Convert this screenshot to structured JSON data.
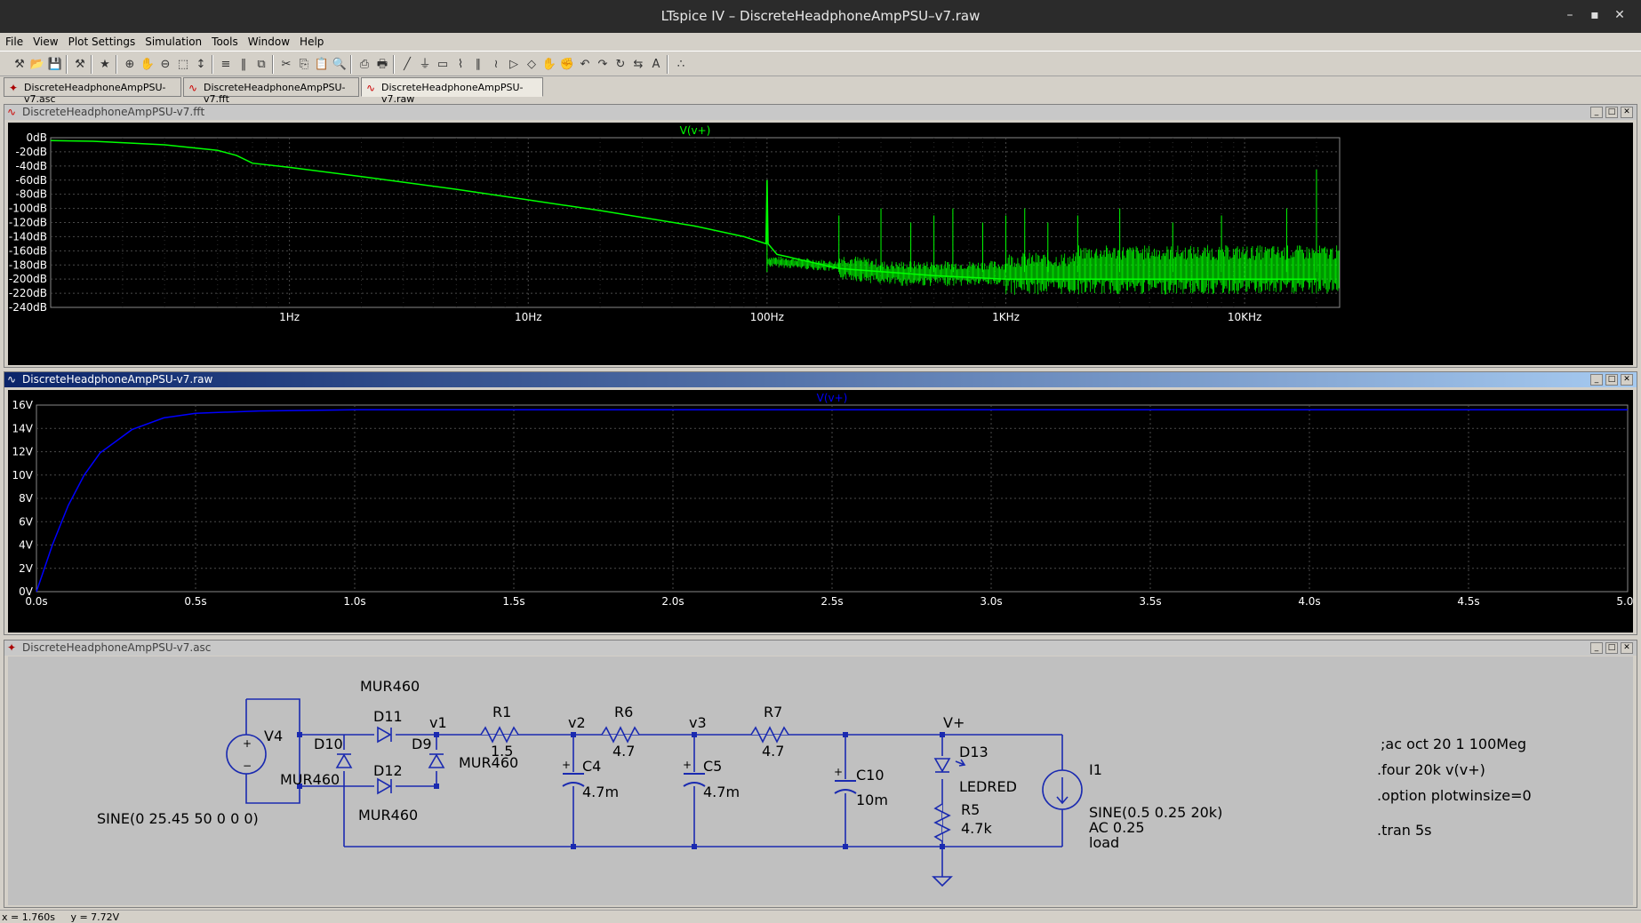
{
  "window": {
    "title": "LTspice IV – DiscreteHeadphoneAmpPSU–v7.raw",
    "minimize": "–",
    "maximize": "▪",
    "close": "✕"
  },
  "menu": [
    "File",
    "View",
    "Plot Settings",
    "Simulation",
    "Tools",
    "Window",
    "Help"
  ],
  "toolbar_icons": [
    "new-schematic",
    "open",
    "save",
    "control-panel",
    "run",
    "zoom-in",
    "pan",
    "zoom-out",
    "zoom-fit",
    "autorange",
    "tile-horizontal",
    "tile-vertical",
    "cascade",
    "cut",
    "copy",
    "paste",
    "find",
    "print-setup",
    "print",
    "wire",
    "ground",
    "label",
    "resistor",
    "capacitor",
    "inductor",
    "diode",
    "component",
    "move",
    "drag",
    "undo",
    "redo",
    "rotate",
    "mirror",
    "text",
    "spice-directive"
  ],
  "tabs": [
    {
      "label": "DiscreteHeadphoneAmpPSU-v7.asc",
      "icon": "schematic-icon"
    },
    {
      "label": "DiscreteHeadphoneAmpPSU-v7.fft",
      "icon": "waveform-icon"
    },
    {
      "label": "DiscreteHeadphoneAmpPSU-v7.raw",
      "icon": "waveform-icon"
    }
  ],
  "fft_window": {
    "title": "DiscreteHeadphoneAmpPSU-v7.fft"
  },
  "raw_window": {
    "title": "DiscreteHeadphoneAmpPSU-v7.raw"
  },
  "asc_window": {
    "title": "DiscreteHeadphoneAmpPSU-v7.asc"
  },
  "colors": {
    "fft_trace": "#00ff00",
    "tran_trace": "#0000ff",
    "plot_bg": "#000000",
    "grid": "#4a4a4a",
    "wire": "#1020a0",
    "schem_bg": "#c0c0c0"
  },
  "chart_data": [
    {
      "type": "line",
      "series": [
        {
          "name": "V(v+)",
          "color": "#00ff00",
          "x": [
            0.1,
            0.15,
            0.2,
            0.3,
            0.5,
            0.6,
            0.7,
            1,
            2,
            5,
            10,
            20,
            50,
            80,
            99,
            100,
            101,
            110,
            200,
            500,
            1000,
            2000,
            5000,
            10000,
            20000
          ],
          "y": [
            -4,
            -5,
            -7,
            -10,
            -18,
            -25,
            -36,
            -42,
            -55,
            -73,
            -88,
            -103,
            -125,
            -140,
            -150,
            -60,
            -150,
            -165,
            -185,
            -195,
            -200,
            -200,
            -200,
            -200,
            -200
          ]
        }
      ],
      "xscale": "log",
      "xlim": [
        0.1,
        25000
      ],
      "ylim": [
        -240,
        0
      ],
      "yticks": [
        "0dB",
        "-20dB",
        "-40dB",
        "-60dB",
        "-80dB",
        "-100dB",
        "-120dB",
        "-140dB",
        "-160dB",
        "-180dB",
        "-200dB",
        "-220dB",
        "-240dB"
      ],
      "xticks": [
        "1Hz",
        "10Hz",
        "100Hz",
        "1KHz",
        "10KHz"
      ],
      "grid": true
    },
    {
      "type": "line",
      "series": [
        {
          "name": "V(v+)",
          "color": "#0000ff",
          "x": [
            0,
            0.02,
            0.05,
            0.1,
            0.15,
            0.2,
            0.3,
            0.4,
            0.5,
            0.7,
            1.0,
            1.5,
            2.0,
            5.0
          ],
          "y": [
            0,
            1.6,
            4.0,
            7.4,
            10.0,
            11.9,
            13.9,
            14.9,
            15.3,
            15.5,
            15.6,
            15.6,
            15.6,
            15.6
          ]
        }
      ],
      "xlim": [
        0,
        5
      ],
      "ylim": [
        0,
        16
      ],
      "yticks": [
        "0V",
        "2V",
        "4V",
        "6V",
        "8V",
        "10V",
        "12V",
        "14V",
        "16V"
      ],
      "xticks": [
        "0.0s",
        "0.5s",
        "1.0s",
        "1.5s",
        "2.0s",
        "2.5s",
        "3.0s",
        "3.5s",
        "4.0s",
        "4.5s",
        "5.0s"
      ],
      "grid": true
    }
  ],
  "schematic": {
    "labels": {
      "v4": "V4",
      "v4_value": "SINE(0 25.45 50 0 0 0)",
      "d10": "D10",
      "d10_part": "MUR460",
      "d11": "D11",
      "d11_part": "MUR460",
      "d9": "D9",
      "d9_part": "MUR460",
      "d12": "D12",
      "d12_part": "MUR460",
      "v1": "v1",
      "r1": "R1",
      "r1_val": "1.5",
      "v2": "v2",
      "c4": "C4",
      "c4_val": "4.7m",
      "r6": "R6",
      "r6_val": "4.7",
      "v3": "v3",
      "c5": "C5",
      "c5_val": "4.7m",
      "r7": "R7",
      "r7_val": "4.7",
      "c10": "C10",
      "c10_val": "10m",
      "vplus": "V+",
      "d13": "D13",
      "d13_part": "LEDRED",
      "r5": "R5",
      "r5_val": "4.7k",
      "i1": "I1",
      "i1_val1": "SINE(0.5 0.25 20k)",
      "i1_val2": "AC 0.25",
      "i1_val3": "load"
    },
    "directives": [
      ";ac oct 20 1 100Meg",
      ".four 20k v(v+)",
      ".option plotwinsize=0",
      ".tran 5s"
    ]
  },
  "status": {
    "x": "x = 1.760s",
    "y": "y = 7.72V"
  }
}
